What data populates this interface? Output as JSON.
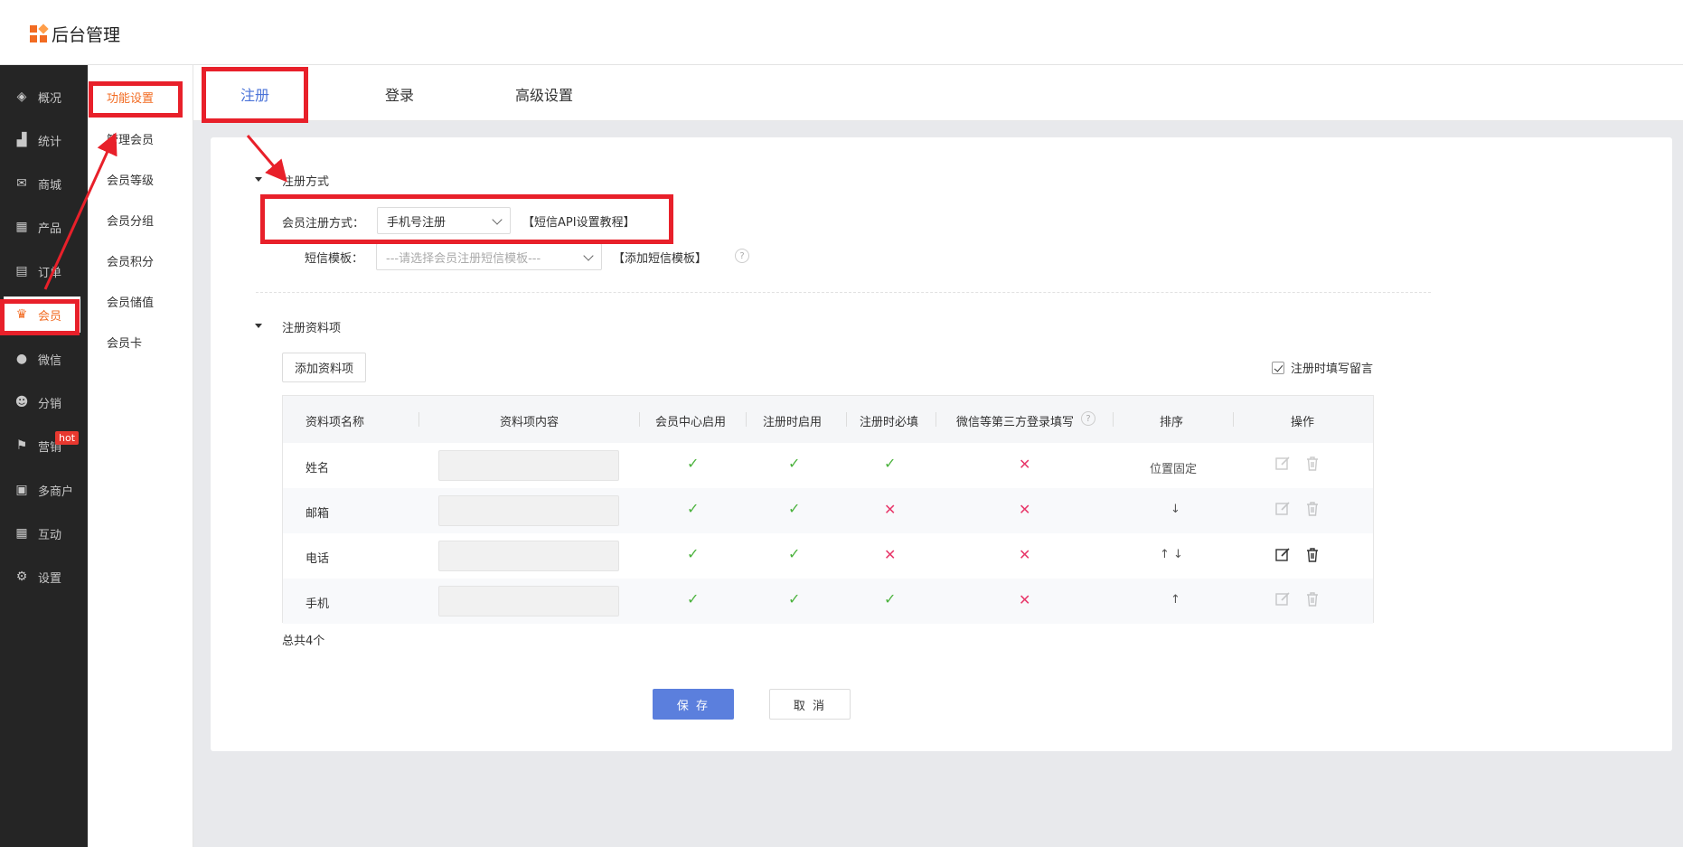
{
  "app": {
    "title": "后台管理"
  },
  "sidebar": {
    "items": [
      {
        "label": "概况",
        "icon": "layers-icon"
      },
      {
        "label": "统计",
        "icon": "chart-icon"
      },
      {
        "label": "商城",
        "icon": "mail-icon"
      },
      {
        "label": "产品",
        "icon": "grid-icon"
      },
      {
        "label": "订单",
        "icon": "clipboard-icon"
      },
      {
        "label": "会员",
        "icon": "crown-icon",
        "active": true
      },
      {
        "label": "微信",
        "icon": "wechat-icon"
      },
      {
        "label": "分销",
        "icon": "users-icon"
      },
      {
        "label": "营销",
        "icon": "flag-icon",
        "badge": "hot"
      },
      {
        "label": "多商户",
        "icon": "store-icon"
      },
      {
        "label": "互动",
        "icon": "apps-icon"
      },
      {
        "label": "设置",
        "icon": "gear-icon"
      }
    ]
  },
  "subnav": {
    "items": [
      {
        "label": "功能设置",
        "active": true
      },
      {
        "label": "管理会员"
      },
      {
        "label": "会员等级"
      },
      {
        "label": "会员分组"
      },
      {
        "label": "会员积分"
      },
      {
        "label": "会员储值"
      },
      {
        "label": "会员卡"
      }
    ]
  },
  "tabs": [
    {
      "label": "注册",
      "active": true
    },
    {
      "label": "登录"
    },
    {
      "label": "高级设置"
    }
  ],
  "register_method": {
    "section_title": "注册方式",
    "method_label": "会员注册方式：",
    "method_value": "手机号注册",
    "sms_api_link": "【短信API设置教程】",
    "sms_template_label": "短信模板：",
    "sms_template_placeholder": "---请选择会员注册短信模板---",
    "add_sms_template_link": "【添加短信模板】",
    "help_mark": "?"
  },
  "register_fields": {
    "section_title": "注册资料项",
    "add_button": "添加资料项",
    "leave_message_checkbox": "注册时填写留言",
    "columns": [
      "资料项名称",
      "资料项内容",
      "会员中心启用",
      "注册时启用",
      "注册时必填",
      "微信等第三方登录填写",
      "排序",
      "操作"
    ],
    "help_mark": "?",
    "rows": [
      {
        "name": "姓名",
        "member_center": true,
        "on_register": true,
        "required": true,
        "third_party": false,
        "sort": "位置固定",
        "editable": false
      },
      {
        "name": "邮箱",
        "member_center": true,
        "on_register": true,
        "required": false,
        "third_party": false,
        "sort": "↓",
        "editable": false
      },
      {
        "name": "电话",
        "member_center": true,
        "on_register": true,
        "required": false,
        "third_party": false,
        "sort": "↑ ↓",
        "editable": true
      },
      {
        "name": "手机",
        "member_center": true,
        "on_register": true,
        "required": true,
        "third_party": false,
        "sort": "↑",
        "editable": false
      }
    ],
    "total": "总共4个"
  },
  "actions": {
    "save": "保 存",
    "cancel": "取 消"
  },
  "colors": {
    "accent": "#f26b22",
    "primary": "#5b7fdd",
    "tab_active": "#4a73d8",
    "highlight": "#e8202a",
    "ok": "#4cb33e",
    "no": "#e8386a"
  }
}
